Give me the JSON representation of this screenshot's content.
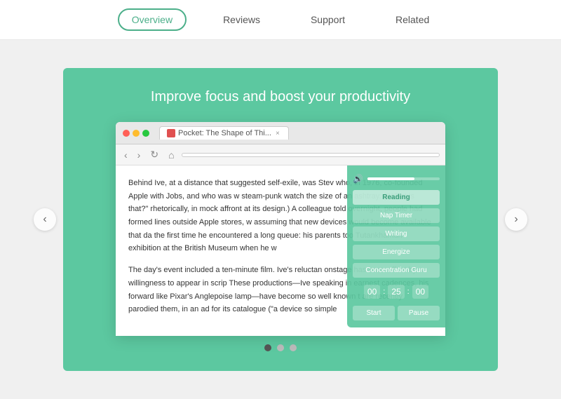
{
  "nav": {
    "items": [
      {
        "label": "Overview",
        "active": true
      },
      {
        "label": "Reviews",
        "active": false
      },
      {
        "label": "Support",
        "active": false
      },
      {
        "label": "Related",
        "active": false
      }
    ]
  },
  "banner": {
    "title": "Improve focus and boost your productivity",
    "browser": {
      "tab_label": "Pocket: The Shape of Thi...",
      "address": "",
      "article_p1": "Behind Ive, at a distance that suggested self-exile, was Stev who, in 1976, co-founded Apple with Jobs, and who was w steam-punk watch the size of an ashtray. (\"What is that?\" rhetorically, in mock affront at its design.) A colleague told overnight, people had formed lines outside Apple stores, w assuming that new devices would become available that da the first time he encountered a long queue: his parents too Tutankhamun exhibition at the British Museum when he w",
      "article_p2": "The day's event included a ten-minute film. Ive's reluctan onstage has been offset by a willingness to appear in scrip These productions—Ive speaking in earnest cadences, his forward like Pixar's Anglepoise lamp—have become so well known t are recently parodied them, in an ad for its catalogue (\"a device so simple"
    },
    "panel": {
      "reading_label": "Reading",
      "nap_label": "Nap Timer",
      "writing_label": "Writing",
      "energize_label": "Energize",
      "concentration_label": "Concentration Guru",
      "timer_h": "00",
      "timer_m": "25",
      "timer_s": "00",
      "start_label": "Start",
      "pause_label": "Pause"
    }
  },
  "pagination": {
    "dots": [
      true,
      false,
      false
    ]
  },
  "arrows": {
    "left": "‹",
    "right": "›"
  }
}
